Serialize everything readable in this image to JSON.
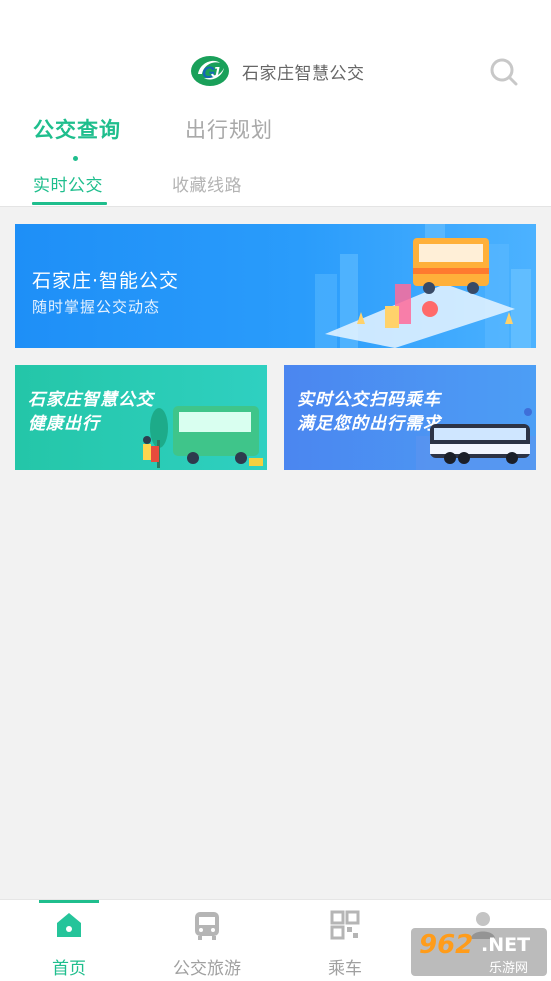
{
  "header": {
    "title": "石家庄智慧公交",
    "logo_icon": "shijiazhuang-bus-logo",
    "search_icon": "search-icon"
  },
  "main_tabs": [
    {
      "label": "公交查询",
      "active": true
    },
    {
      "label": "出行规划",
      "active": false
    }
  ],
  "sub_tabs": [
    {
      "label": "实时公交",
      "active": true
    },
    {
      "label": "收藏线路",
      "active": false
    }
  ],
  "banner": {
    "title": "石家庄·智能公交",
    "subtitle": "随时掌握公交动态"
  },
  "cards": [
    {
      "line1": "石家庄智慧公交",
      "line2": "健康出行"
    },
    {
      "line1": "实时公交扫码乘车",
      "line2": "满足您的出行需求"
    }
  ],
  "bottom_nav": [
    {
      "label": "首页",
      "icon": "home-icon",
      "active": true
    },
    {
      "label": "公交旅游",
      "icon": "bus-icon",
      "active": false
    },
    {
      "label": "乘车",
      "icon": "qr-code-icon",
      "active": false
    },
    {
      "label": "",
      "icon": "user-icon",
      "active": false
    }
  ],
  "watermark": {
    "number": "962",
    "suffix": ".NET",
    "text": "乐游网"
  },
  "colors": {
    "accent": "#1fbe8d",
    "inactive_text": "#a9a9a9",
    "background": "#f2f2f2",
    "banner_blue": "#1e8ff7",
    "card_green": "#24c6a8",
    "card_blue": "#4b86f0"
  }
}
